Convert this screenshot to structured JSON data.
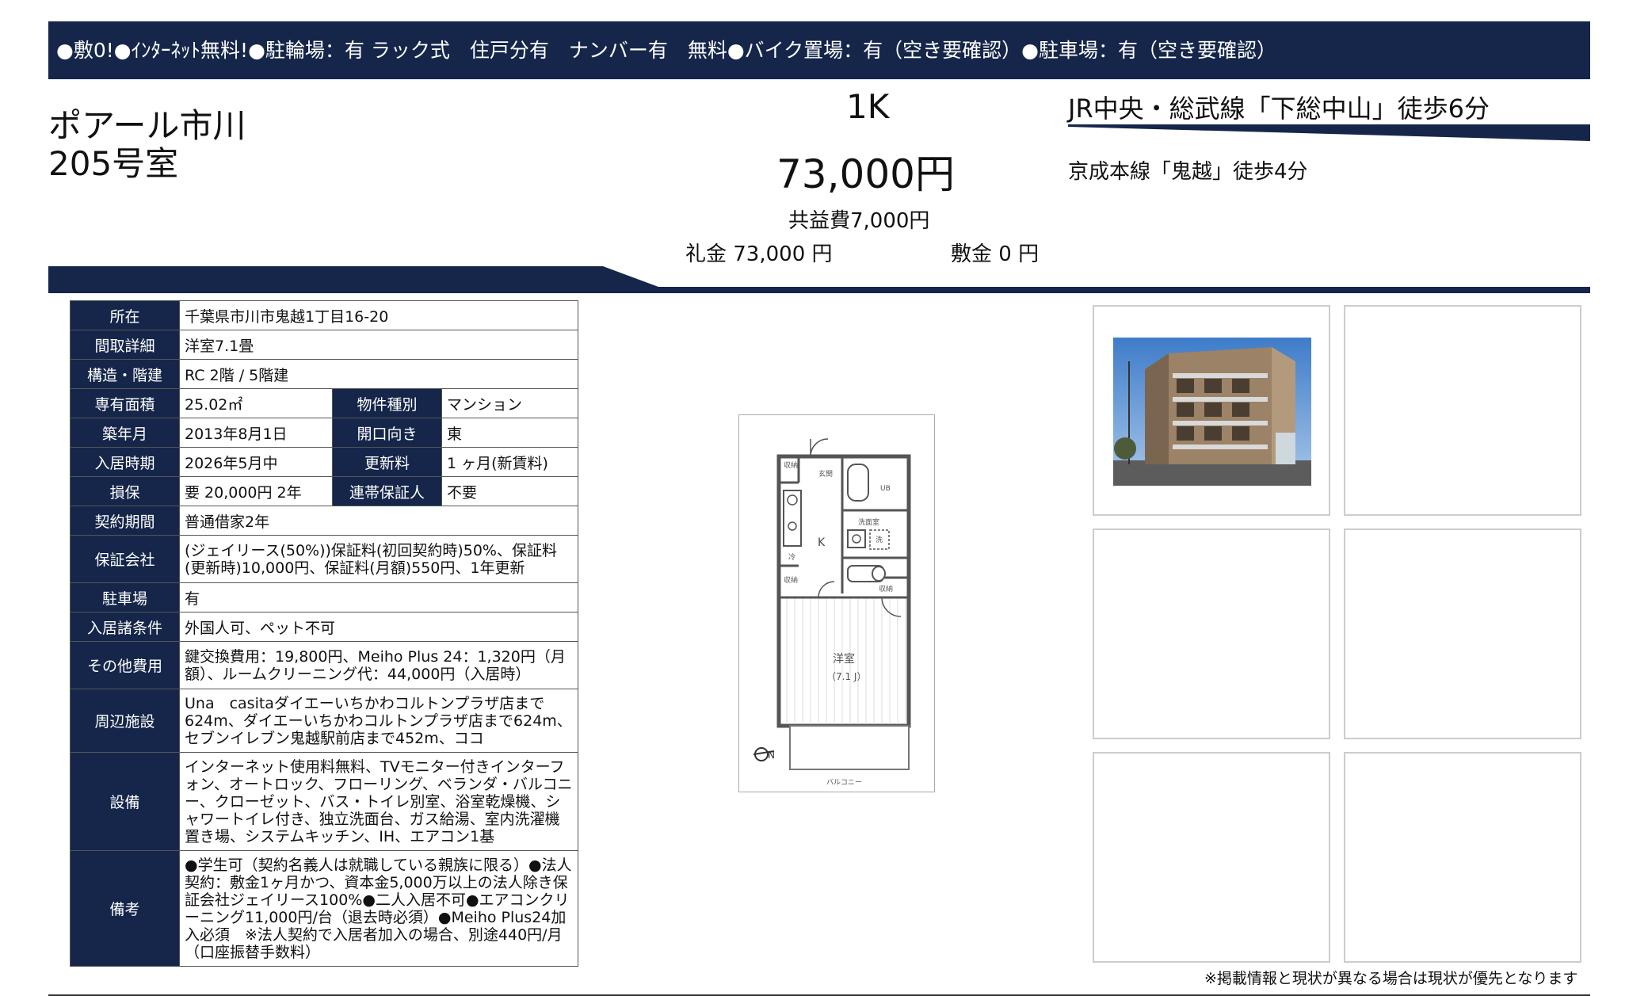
{
  "banner": "●敷0!●ｲﾝﾀｰﾈｯﾄ無料!●駐輪場：有 ラック式　住戸分有　ナンバー有　無料●バイク置場：有（空き要確認）●駐車場：有（空き要確認）",
  "property": {
    "name": "ポアール市川",
    "room": "205号室",
    "layout": "1K",
    "rent": "73,000円",
    "common_fee": "共益費7,000円",
    "reikin": "礼金 73,000 円",
    "shikikin": "敷金 0 円",
    "station1": "JR中央・総武線「下総中山」徒歩6分",
    "station2": "京成本線「鬼越」徒歩4分"
  },
  "spec": {
    "address_label": "所在",
    "address": "千葉県市川市鬼越1丁目16-20",
    "madori_label": "間取詳細",
    "madori": "洋室7.1畳",
    "structure_label": "構造・階建",
    "structure": "RC 2階 / 5階建",
    "area_label": "専有面積",
    "area": "25.02㎡",
    "type_label": "物件種別",
    "type": "マンション",
    "built_label": "築年月",
    "built": "2013年8月1日",
    "direction_label": "開口向き",
    "direction": "東",
    "movein_label": "入居時期",
    "movein": "2026年5月中",
    "renewal_label": "更新料",
    "renewal": "1 ヶ月(新賃料)",
    "deposit_label": "損保",
    "deposit": "要 20,000円 2年",
    "guarantor_label": "連帯保証人",
    "guarantor": "不要",
    "contract_label": "契約期間",
    "contract": "普通借家2年",
    "guarantee_label": "保証会社",
    "guarantee": "(ジェイリース(50%))保証料(初回契約時)50%、保証料(更新時)10,000円、保証料(月額)550円、1年更新",
    "parking_label": "駐車場",
    "parking": "有",
    "conditions_label": "入居諸条件",
    "conditions": "外国人可、ペット不可",
    "other_label": "その他費用",
    "other": "鍵交換費用：19,800円、Meiho Plus 24：1,320円（月額）、ルームクリーニング代：44,000円（入居時）",
    "nearby_label": "周辺施設",
    "nearby": "Una　casitaダイエーいちかわコルトンプラザ店まで624m、ダイエーいちかわコルトンプラザ店まで624m、セブンイレブン鬼越駅前店まで452m、ココ",
    "equipment_label": "設備",
    "equipment": "インターネット使用料無料、TVモニター付きインターフォン、オートロック、フローリング、ベランダ・バルコニー、クローゼット、バス・トイレ別室、浴室乾燥機、シャワートイレ付き、独立洗面台、ガス給湯、室内洗濯機置き場、システムキッチン、IH、エアコン1基",
    "notes_label": "備考",
    "notes": "●学生可（契約名義人は就職している親族に限る）●法人契約：敷金1ヶ月かつ、資本金5,000万以上の法人除き保証会社ジェイリース100%●二人入居不可●エアコンクリーニング11,000円/台（退去時必須）●Meiho Plus24加入必須　※法人契約で入居者加入の場合、別途440円/月（口座振替手数料）"
  },
  "floorplan": {
    "shuno1": "収納",
    "genkan": "玄関",
    "ub": "UB",
    "senmen": "洗面室",
    "k": "K",
    "rei": "冷",
    "sen": "洗",
    "shuno2": "収納",
    "shuno3": "収納",
    "youshitsu": "洋室",
    "youshitsu_size": "（7.1 J）",
    "balcony": "バルコニー"
  },
  "footer_note": "※掲載情報と現状が異なる場合は現状が優先となります",
  "colors": {
    "navy": "#15264a"
  }
}
